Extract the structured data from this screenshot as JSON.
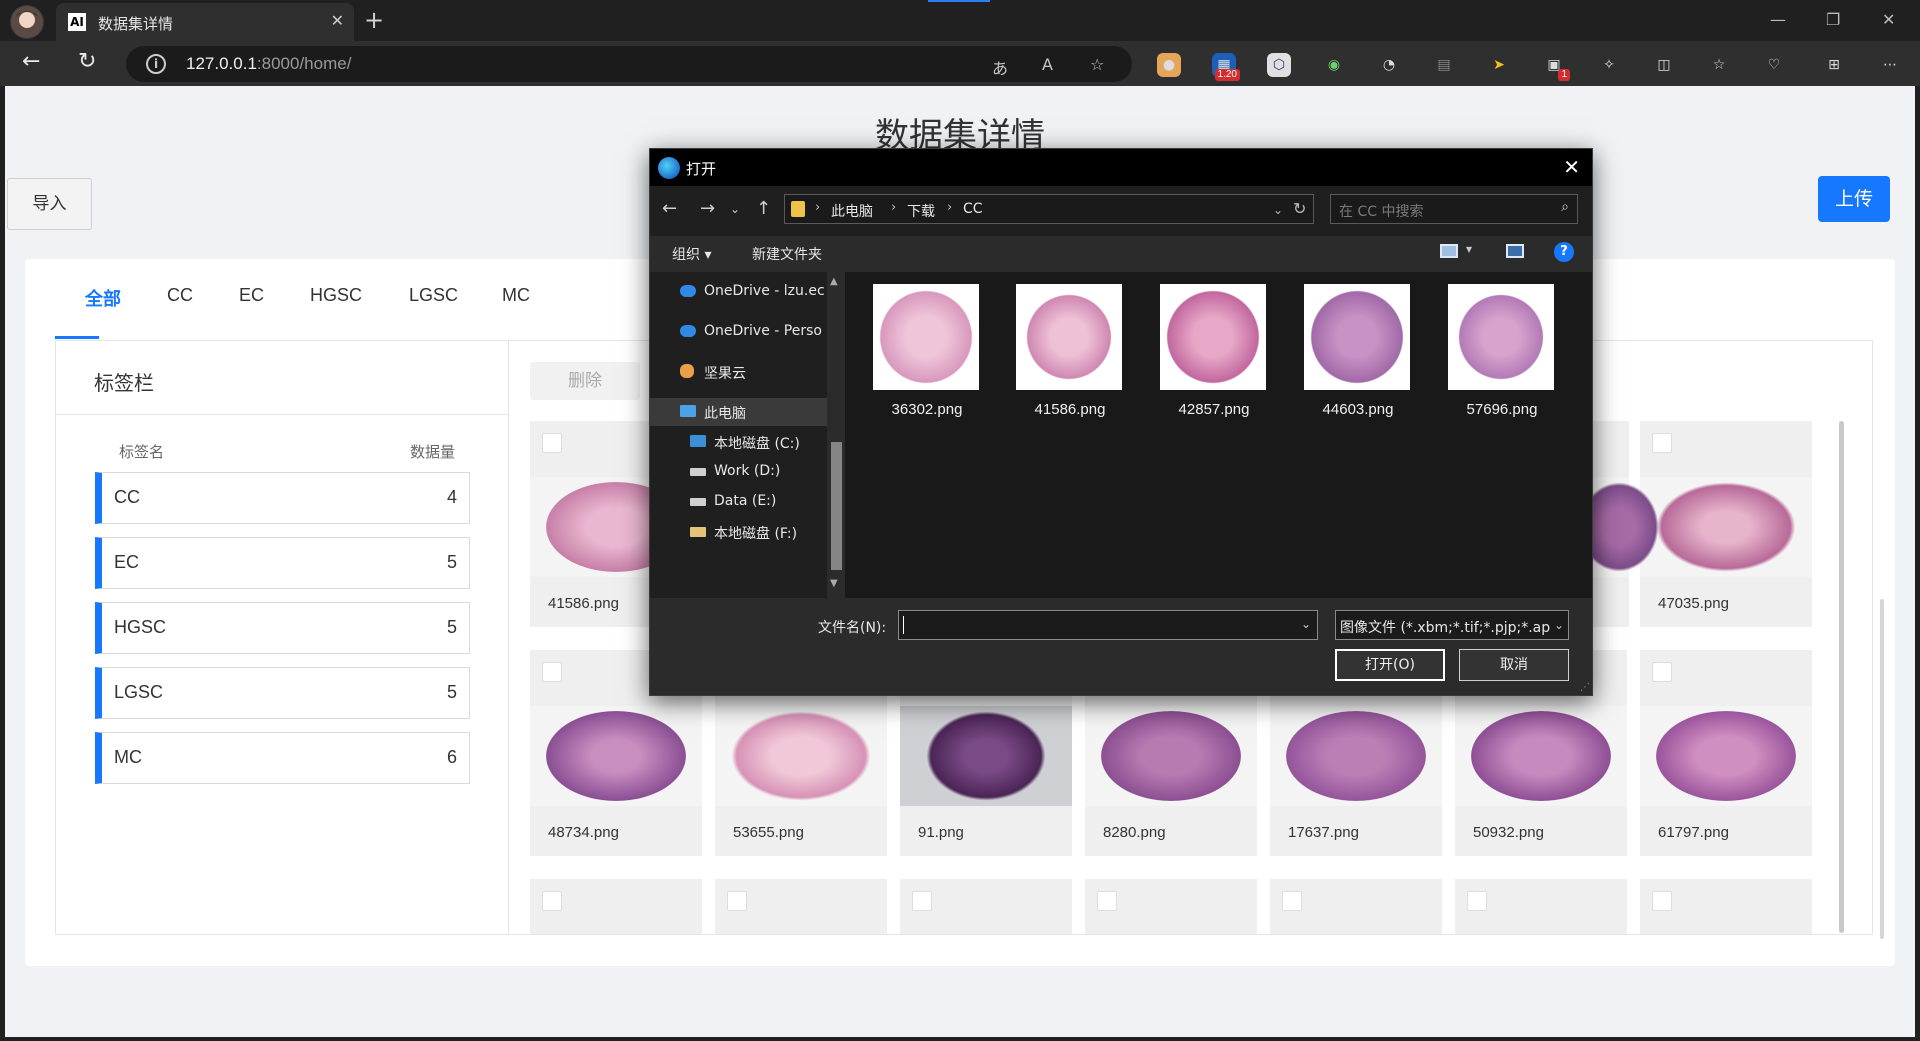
{
  "browser": {
    "tab_title": "数据集详情",
    "tab_favicon": "AI",
    "url_host": "127.0.0.1",
    "url_path": ":8000/home/",
    "extension_badges": {
      "ext2": "1.20",
      "ext8": "1"
    }
  },
  "page": {
    "title": "数据集详情",
    "import_label": "导入",
    "upload_label": "上传",
    "tabs": [
      {
        "label": "全部",
        "active": true
      },
      {
        "label": "CC",
        "active": false
      },
      {
        "label": "EC",
        "active": false
      },
      {
        "label": "HGSC",
        "active": false
      },
      {
        "label": "LGSC",
        "active": false
      },
      {
        "label": "MC",
        "active": false
      }
    ],
    "label_panel": {
      "title": "标签栏",
      "col_name": "标签名",
      "col_count": "数据量",
      "rows": [
        {
          "name": "CC",
          "count": "4"
        },
        {
          "name": "EC",
          "count": "5"
        },
        {
          "name": "HGSC",
          "count": "5"
        },
        {
          "name": "LGSC",
          "count": "5"
        },
        {
          "name": "MC",
          "count": "6"
        }
      ]
    },
    "delete_label": "删除",
    "row1_files": [
      "41586.png",
      "47035.png"
    ],
    "row2_files": [
      "48734.png",
      "53655.png",
      "91.png",
      "8280.png",
      "17637.png",
      "50932.png",
      "61797.png"
    ]
  },
  "dialog": {
    "title": "打开",
    "breadcrumb": [
      "此电脑",
      "下载",
      "CC"
    ],
    "search_placeholder": "在 CC 中搜索",
    "organize_label": "组织",
    "new_folder_label": "新建文件夹",
    "nav_items": [
      {
        "label": "OneDrive - lzu.ec"
      },
      {
        "label": "OneDrive - Perso"
      },
      {
        "label": "坚果云"
      },
      {
        "label": "此电脑",
        "selected": true
      },
      {
        "label": "本地磁盘 (C:)"
      },
      {
        "label": "Work (D:)"
      },
      {
        "label": "Data (E:)"
      },
      {
        "label": "本地磁盘 (F:)"
      }
    ],
    "files": [
      "36302.png",
      "41586.png",
      "42857.png",
      "44603.png",
      "57696.png"
    ],
    "filename_label": "文件名(N):",
    "filename_value": "",
    "filter_label": "图像文件 (*.xbm;*.tif;*.pjp;*.apng",
    "open_label": "打开(O)",
    "cancel_label": "取消"
  },
  "colors": {
    "accent": "#1677ff",
    "tissue_pink": "#d98fb8",
    "tissue_purple": "#9b5aa0"
  }
}
